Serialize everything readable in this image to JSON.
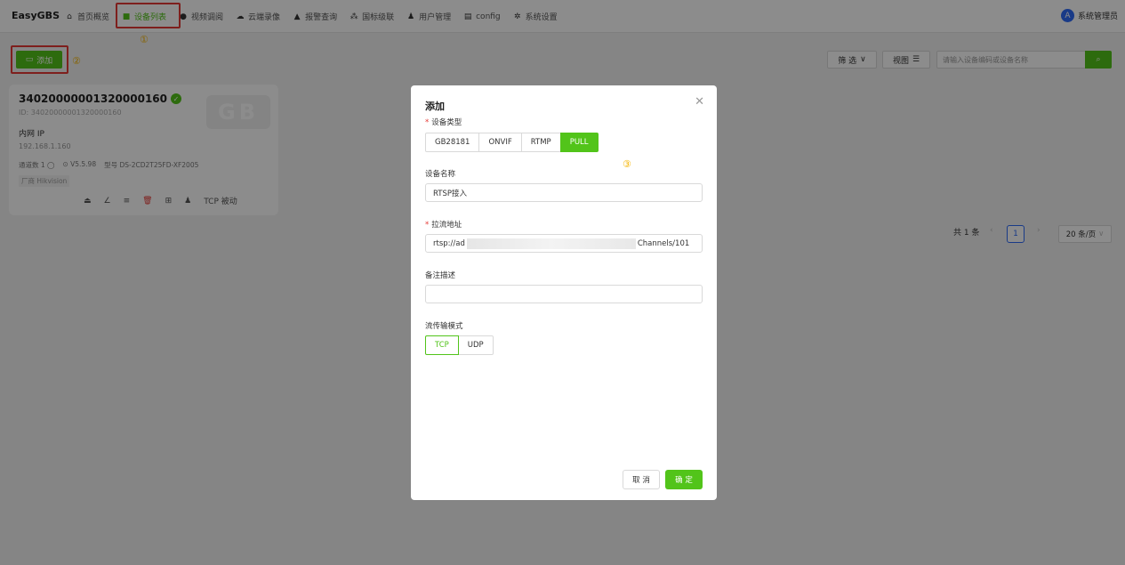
{
  "app": {
    "brand": "EasyGBS"
  },
  "nav": {
    "items": [
      {
        "icon": "home-icon",
        "glyph": "⌂",
        "label": "首页概览"
      },
      {
        "icon": "camera-icon",
        "glyph": "■",
        "label": "设备列表"
      },
      {
        "icon": "play-circle-icon",
        "glyph": "●",
        "label": "视频调阅"
      },
      {
        "icon": "cloud-icon",
        "glyph": "☁",
        "label": "云端录像"
      },
      {
        "icon": "alarm-icon",
        "glyph": "▲",
        "label": "报警查询"
      },
      {
        "icon": "cascade-icon",
        "glyph": "⁂",
        "label": "国标级联"
      },
      {
        "icon": "users-icon",
        "glyph": "♟",
        "label": "用户管理"
      },
      {
        "icon": "config-icon",
        "glyph": "▤",
        "label": "config"
      },
      {
        "icon": "gear-icon",
        "glyph": "✲",
        "label": "系统设置"
      }
    ],
    "active_index": 1
  },
  "user": {
    "avatar_glyph": "A",
    "name": "系统管理员"
  },
  "callouts": {
    "one": "①",
    "two": "②",
    "three": "③"
  },
  "toolbar": {
    "add_icon": "▭",
    "add_label": "添加",
    "filter_label": "筛 选",
    "filter_glyph": "∨",
    "view_label": "视图",
    "view_glyph": "☰",
    "search_placeholder": "请输入设备编码或设备名称",
    "search_glyph": "⌕"
  },
  "device_card": {
    "name": "34020000001320000160",
    "status_glyph": "✓",
    "id_text": "ID: 34020000001320000160",
    "watermark": "GB",
    "ip_label": "内网 IP",
    "ip": "192.168.1.160",
    "channels": "通道数 1 ◯",
    "version": "⊙ V5.5.98",
    "model": "型号 DS-2CD2T25FD-XF2005",
    "vendor": "厂商 Hikvision",
    "actions": {
      "play": "⏏",
      "edit": "∠",
      "list": "≡",
      "delete": "🗑",
      "grid": "⊞",
      "person": "♟",
      "transport": "TCP 被动"
    }
  },
  "pagination": {
    "total": "共 1 条",
    "prev": "‹",
    "page": "1",
    "next": "›",
    "page_size": "20 条/页",
    "size_glyph": "∨"
  },
  "modal": {
    "title": "添加",
    "close_glyph": "✕",
    "required_mark": "*",
    "device_type_label": "设备类型",
    "device_types": [
      "GB28181",
      "ONVIF",
      "RTMP",
      "PULL"
    ],
    "selected_type": "PULL",
    "device_name_label": "设备名称",
    "device_name_value": "RTSP接入",
    "stream_url_label": "拉流地址",
    "stream_url_prefix": "rtsp://ad",
    "stream_url_suffix": "Channels/101",
    "remark_label": "备注描述",
    "remark_value": "",
    "transport_label": "流传输模式",
    "transport_options": [
      "TCP",
      "UDP"
    ],
    "selected_transport": "TCP",
    "cancel_label": "取 消",
    "ok_label": "确 定"
  },
  "colors": {
    "accent": "#52c41a",
    "highlight": "#e53935",
    "callout": "#f5b400",
    "link": "#2f6bf6"
  }
}
